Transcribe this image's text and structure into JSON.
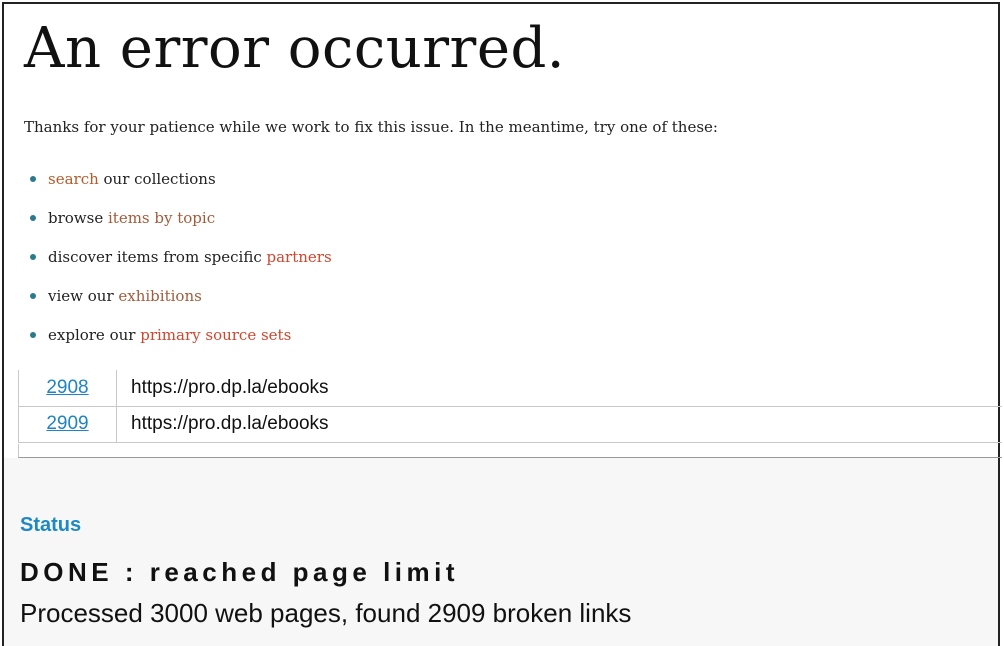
{
  "error_page": {
    "title": "An error occurred.",
    "intro": "Thanks for your patience while we work to fix this issue. In the meantime, try one of these:",
    "suggestions": [
      {
        "before": "",
        "link": "search",
        "after": " our collections"
      },
      {
        "before": "browse ",
        "link": "items by topic",
        "after": ""
      },
      {
        "before": "discover items from specific ",
        "link": "partners",
        "after": ""
      },
      {
        "before": "view our ",
        "link": "exhibitions",
        "after": ""
      },
      {
        "before": "explore our ",
        "link": "primary source sets",
        "after": ""
      }
    ]
  },
  "results_table": {
    "rows": [
      {
        "number": "2908",
        "url": "https://pro.dp.la/ebooks"
      },
      {
        "number": "2909",
        "url": "https://pro.dp.la/ebooks"
      }
    ]
  },
  "status": {
    "label": "Status",
    "value": "DONE : reached page limit",
    "summary": "Processed 3000 web pages, found 2909 broken links"
  },
  "colors": {
    "link_brown": "#b55a28",
    "link_red": "#d2452d",
    "link_blue": "#1e84c6",
    "status_blue": "#1e88c7"
  }
}
